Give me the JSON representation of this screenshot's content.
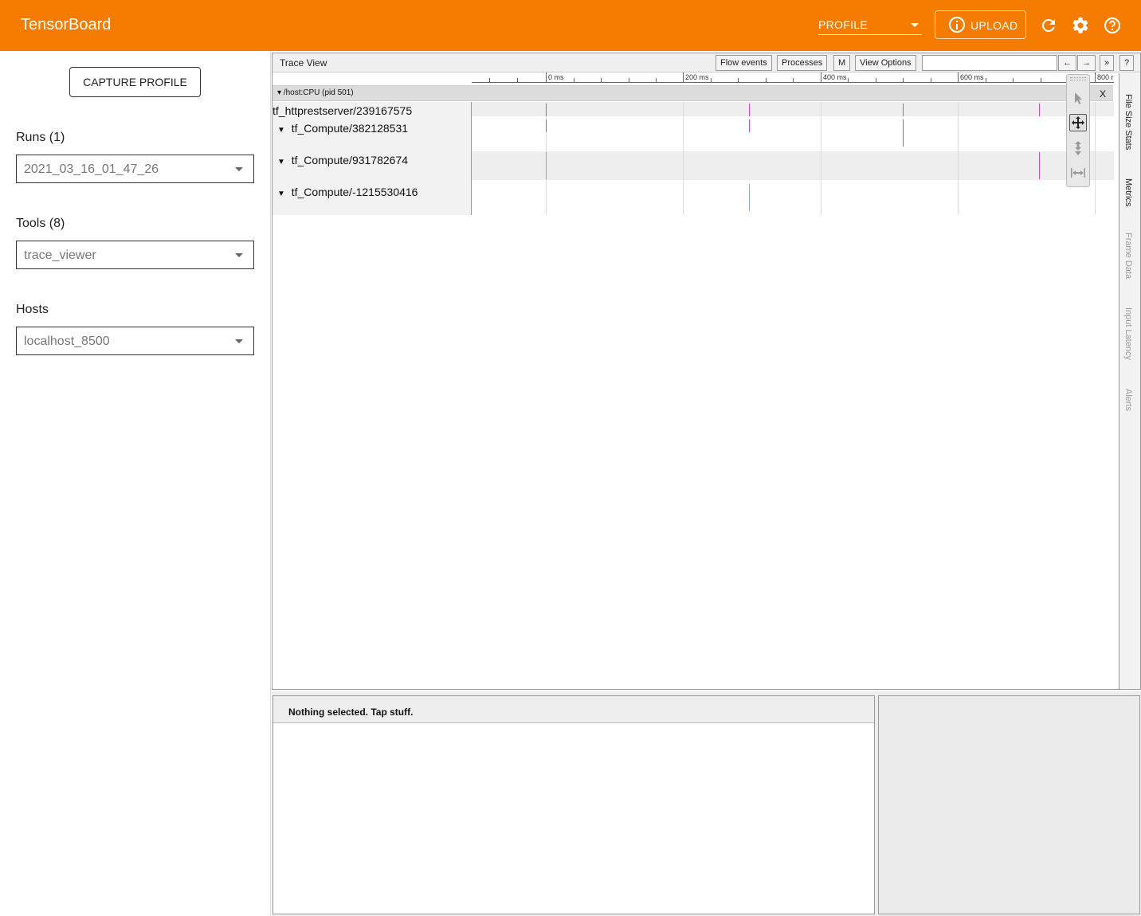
{
  "header": {
    "title": "TensorBoard",
    "plugin_value": "PROFILE",
    "upload_label": "UPLOAD",
    "icons": [
      "refresh-icon",
      "settings-icon",
      "help-icon"
    ]
  },
  "sidebar": {
    "capture_label": "CAPTURE PROFILE",
    "runs": {
      "label": "Runs (1)",
      "value": "2021_03_16_01_47_26"
    },
    "tools": {
      "label": "Tools (8)",
      "value": "trace_viewer"
    },
    "hosts": {
      "label": "Hosts",
      "value": "localhost_8500"
    }
  },
  "trace": {
    "title": "Trace View",
    "buttons": {
      "flow": "Flow events",
      "processes": "Processes",
      "m": "M",
      "options": "View Options",
      "prev": "←",
      "next": "→",
      "more": "»",
      "help": "?"
    },
    "ruler": [
      "0 ms",
      "200 ms",
      "400 ms",
      "600 ms",
      "800 r"
    ],
    "process": {
      "label": "/host:CPU (pid 501)",
      "close": "X"
    },
    "threads": [
      {
        "label": "tf_httprestserver/239167575",
        "toggle": ""
      },
      {
        "label": "tf_Compute/382128531",
        "toggle": "▼"
      },
      {
        "label": "tf_Compute/931782674",
        "toggle": "▼"
      },
      {
        "label": "tf_Compute/-1215530416",
        "toggle": "▼"
      }
    ],
    "side_tabs": [
      "File Size Stats",
      "Metrics",
      "Frame Data",
      "Input Latency",
      "Alerts"
    ]
  },
  "analysis": {
    "message": "Nothing selected. Tap stuff."
  },
  "colors": {
    "accent": "#f57c00",
    "event": "#e040c0"
  }
}
